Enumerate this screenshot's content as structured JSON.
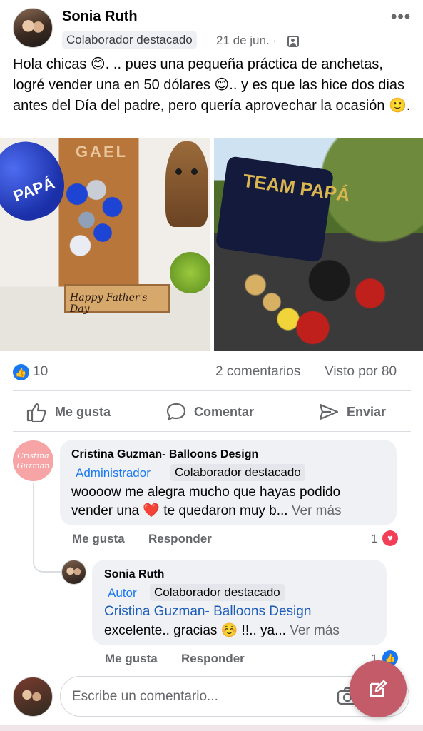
{
  "post": {
    "author": "Sonia Ruth",
    "badge": "Colaborador destacado",
    "date": "21 de jun. ·",
    "text": "Hola chicas 😊. .. pues una pequeña práctica de anchetas, logré vender una en 50 dólares 😊.. y es que las hice dos dias antes del Día del padre, pero quería aprovechar la ocasión 🙂."
  },
  "photos": {
    "left": {
      "door_text": "GAEL",
      "balloon_text": "PAPÁ",
      "crate_text": "Happy Father's Day"
    },
    "right": {
      "balloon_text": "TEAM PAPÁ"
    }
  },
  "stats": {
    "likes": "10",
    "comments": "2 comentarios",
    "seen_by": "Visto por 80"
  },
  "actions": {
    "like": "Me gusta",
    "comment": "Comentar",
    "send": "Enviar"
  },
  "comments": [
    {
      "author": "Cristina Guzman- Balloons Design",
      "avatar_text": "Cristina Guzman",
      "role": "Administrador",
      "badge": "Colaborador destacado",
      "text_line1": "woooow me alegra mucho que hayas podido",
      "text_line2": "vender una ❤️ te quedaron muy b...",
      "see_more": "Ver más",
      "like_label": "Me gusta",
      "reply_label": "Responder",
      "reaction_count": "1",
      "reaction": "heart"
    },
    {
      "author": "Sonia Ruth",
      "role": "Autor",
      "badge": "Colaborador destacado",
      "mention": "Cristina Guzman- Balloons Design",
      "text_line": "excelente.. gracias ☺️ !!.. ya...",
      "see_more": "Ver más",
      "like_label": "Me gusta",
      "reply_label": "Responder",
      "reaction_count": "1",
      "reaction": "like"
    }
  ],
  "composer": {
    "placeholder": "Escribe un comentario..."
  },
  "colors": {
    "facebook_blue": "#1877f2",
    "fab": "#c45b69",
    "heart": "#f33e58"
  },
  "icons": [
    "more-dots-icon",
    "group-icon",
    "like-icon",
    "comment-icon",
    "send-icon",
    "heart-reaction-icon",
    "like-reaction-icon",
    "camera-icon",
    "edit-icon"
  ]
}
